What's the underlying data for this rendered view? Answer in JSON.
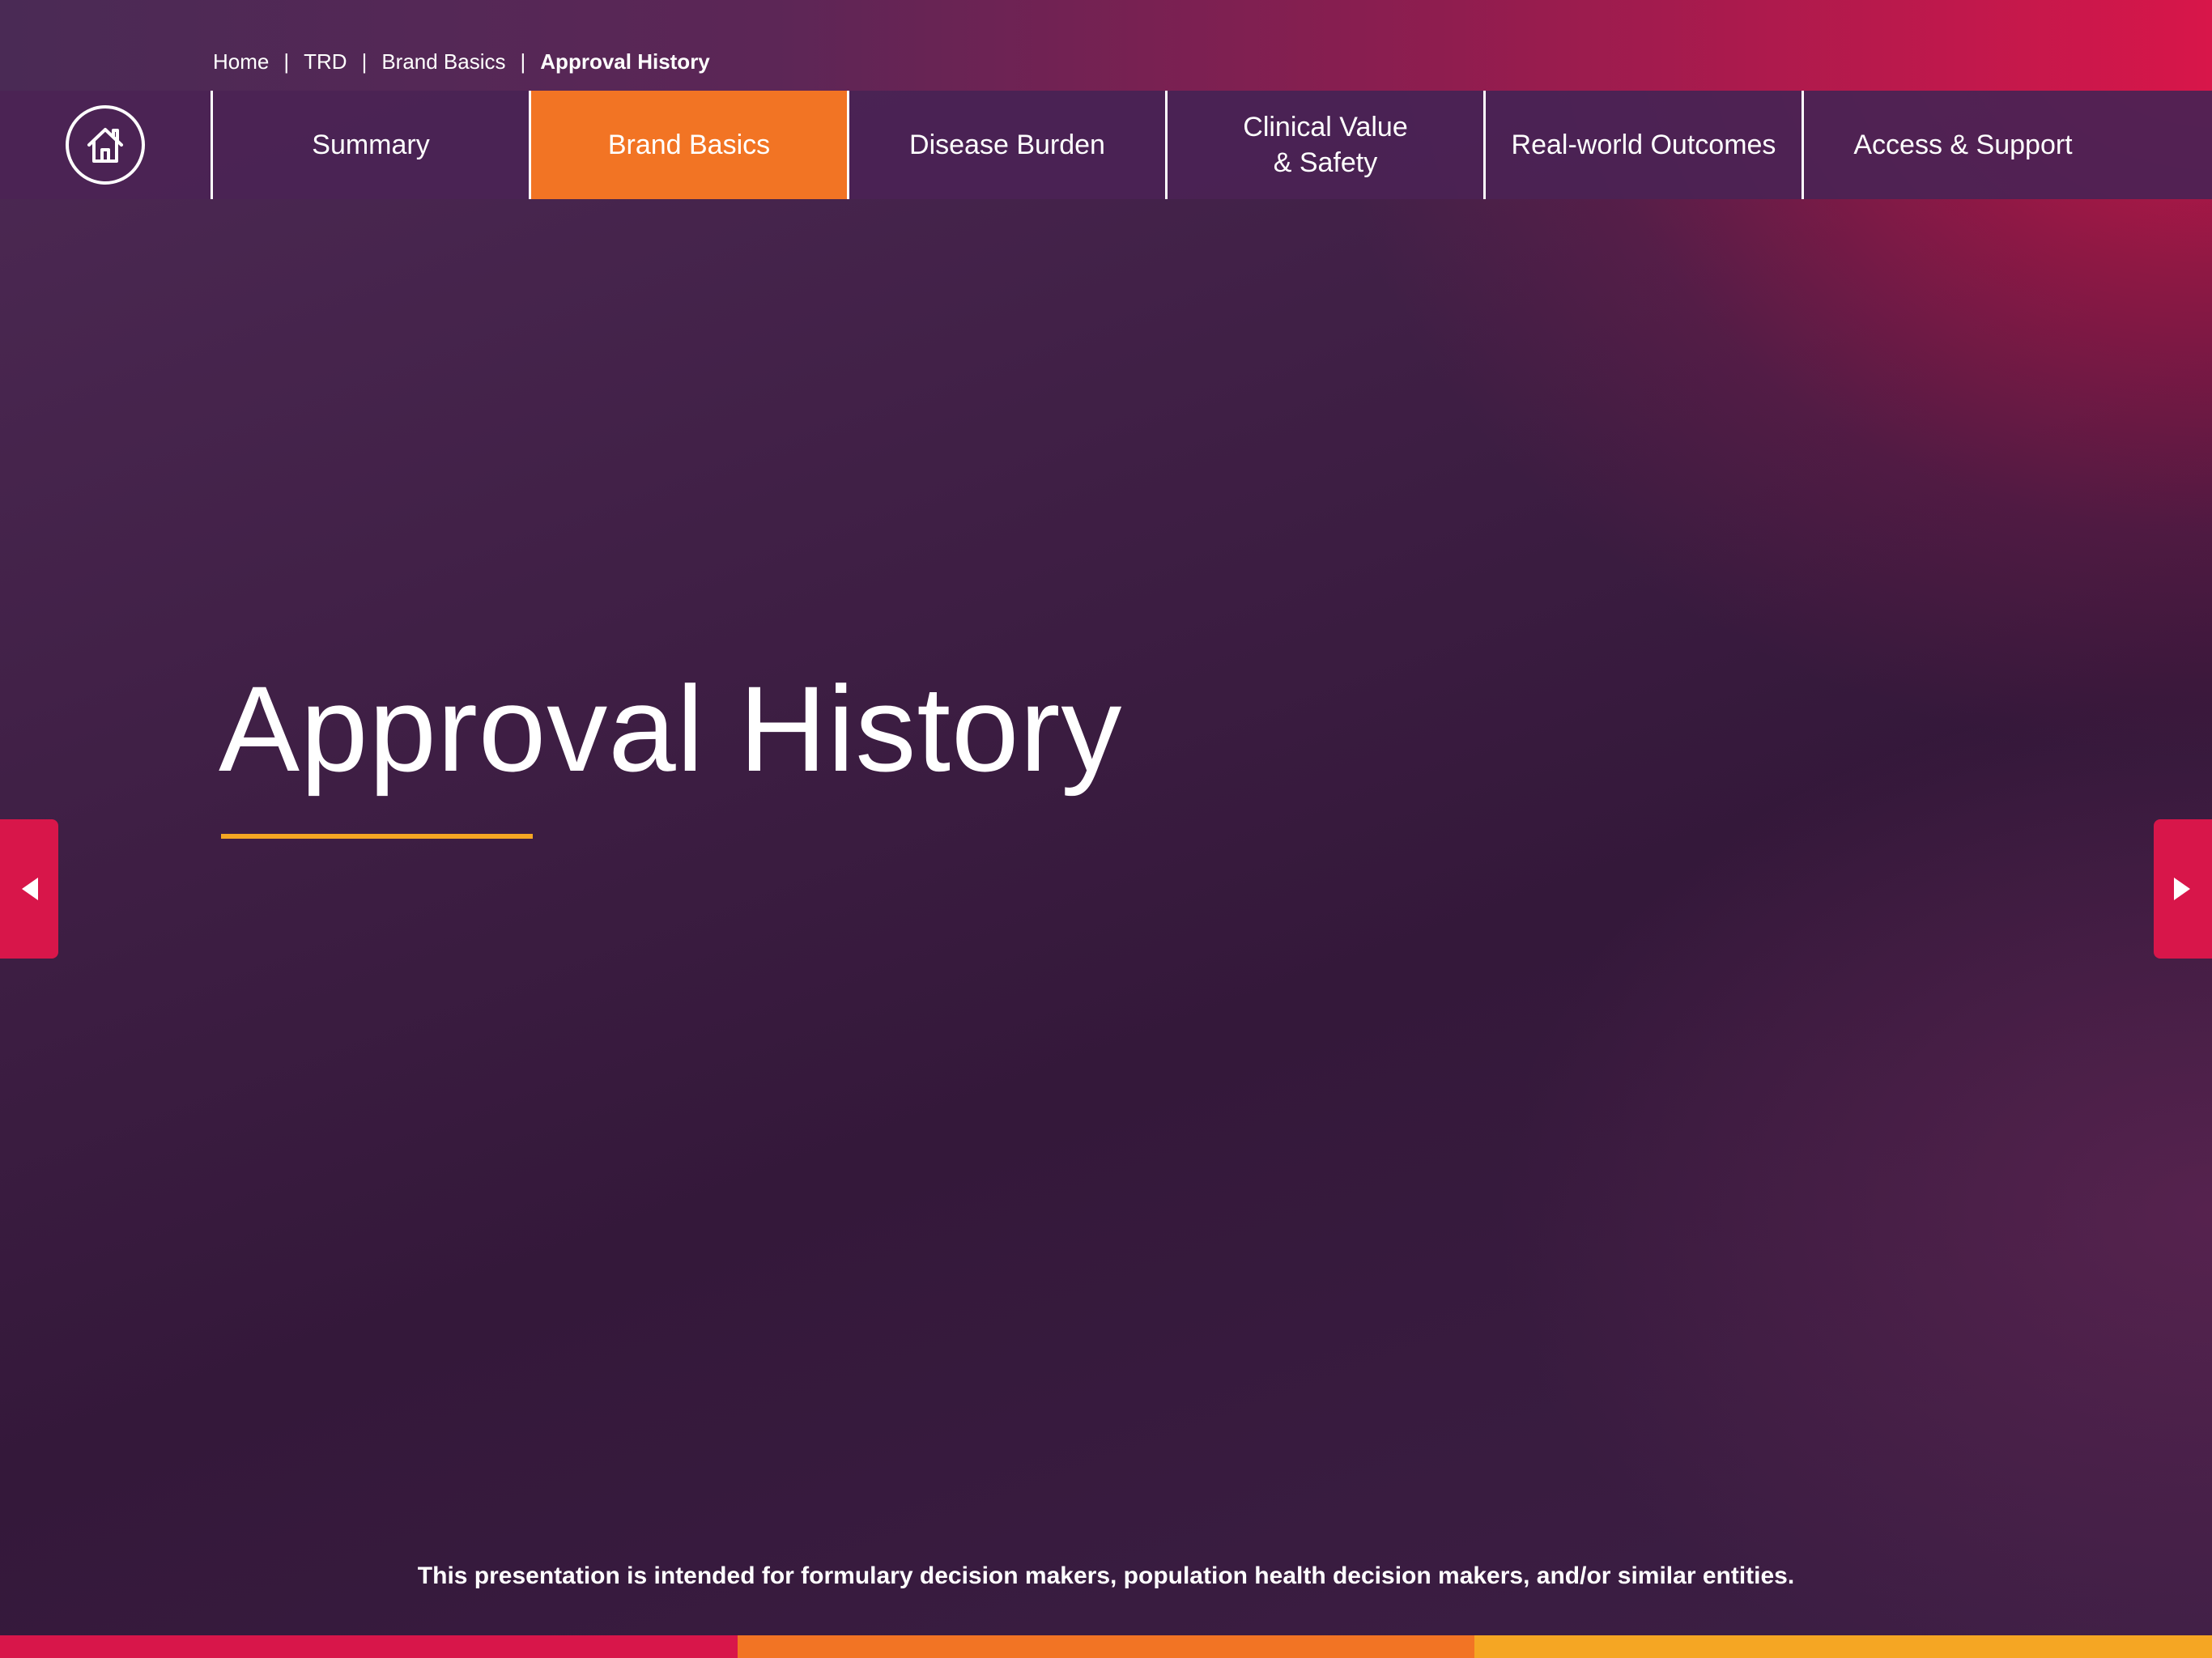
{
  "breadcrumb": {
    "items": [
      "Home",
      "TRD",
      "Brand Basics"
    ],
    "current": "Approval History",
    "separator": "|"
  },
  "nav": {
    "home_icon": "home-icon",
    "tabs": [
      {
        "label": "Summary",
        "active": false
      },
      {
        "label": "Brand Basics",
        "active": true
      },
      {
        "label": "Disease Burden",
        "active": false
      },
      {
        "label": "Clinical Value\n& Safety",
        "active": false
      },
      {
        "label": "Real-world Outcomes",
        "active": false
      },
      {
        "label": "Access & Support",
        "active": false
      }
    ]
  },
  "main": {
    "title": "Approval History"
  },
  "navigation_arrows": {
    "prev_icon": "arrow-left-icon",
    "next_icon": "arrow-right-icon"
  },
  "footer": {
    "disclaimer": "This presentation is intended for formulary decision makers, population health decision makers, and/or similar entities."
  },
  "colors": {
    "active_tab": "#f27424",
    "accent_red": "#d8164a",
    "title_rule": "#f5a623",
    "bottom_bar": [
      "#d8164a",
      "#f27424",
      "#f5a623"
    ]
  }
}
